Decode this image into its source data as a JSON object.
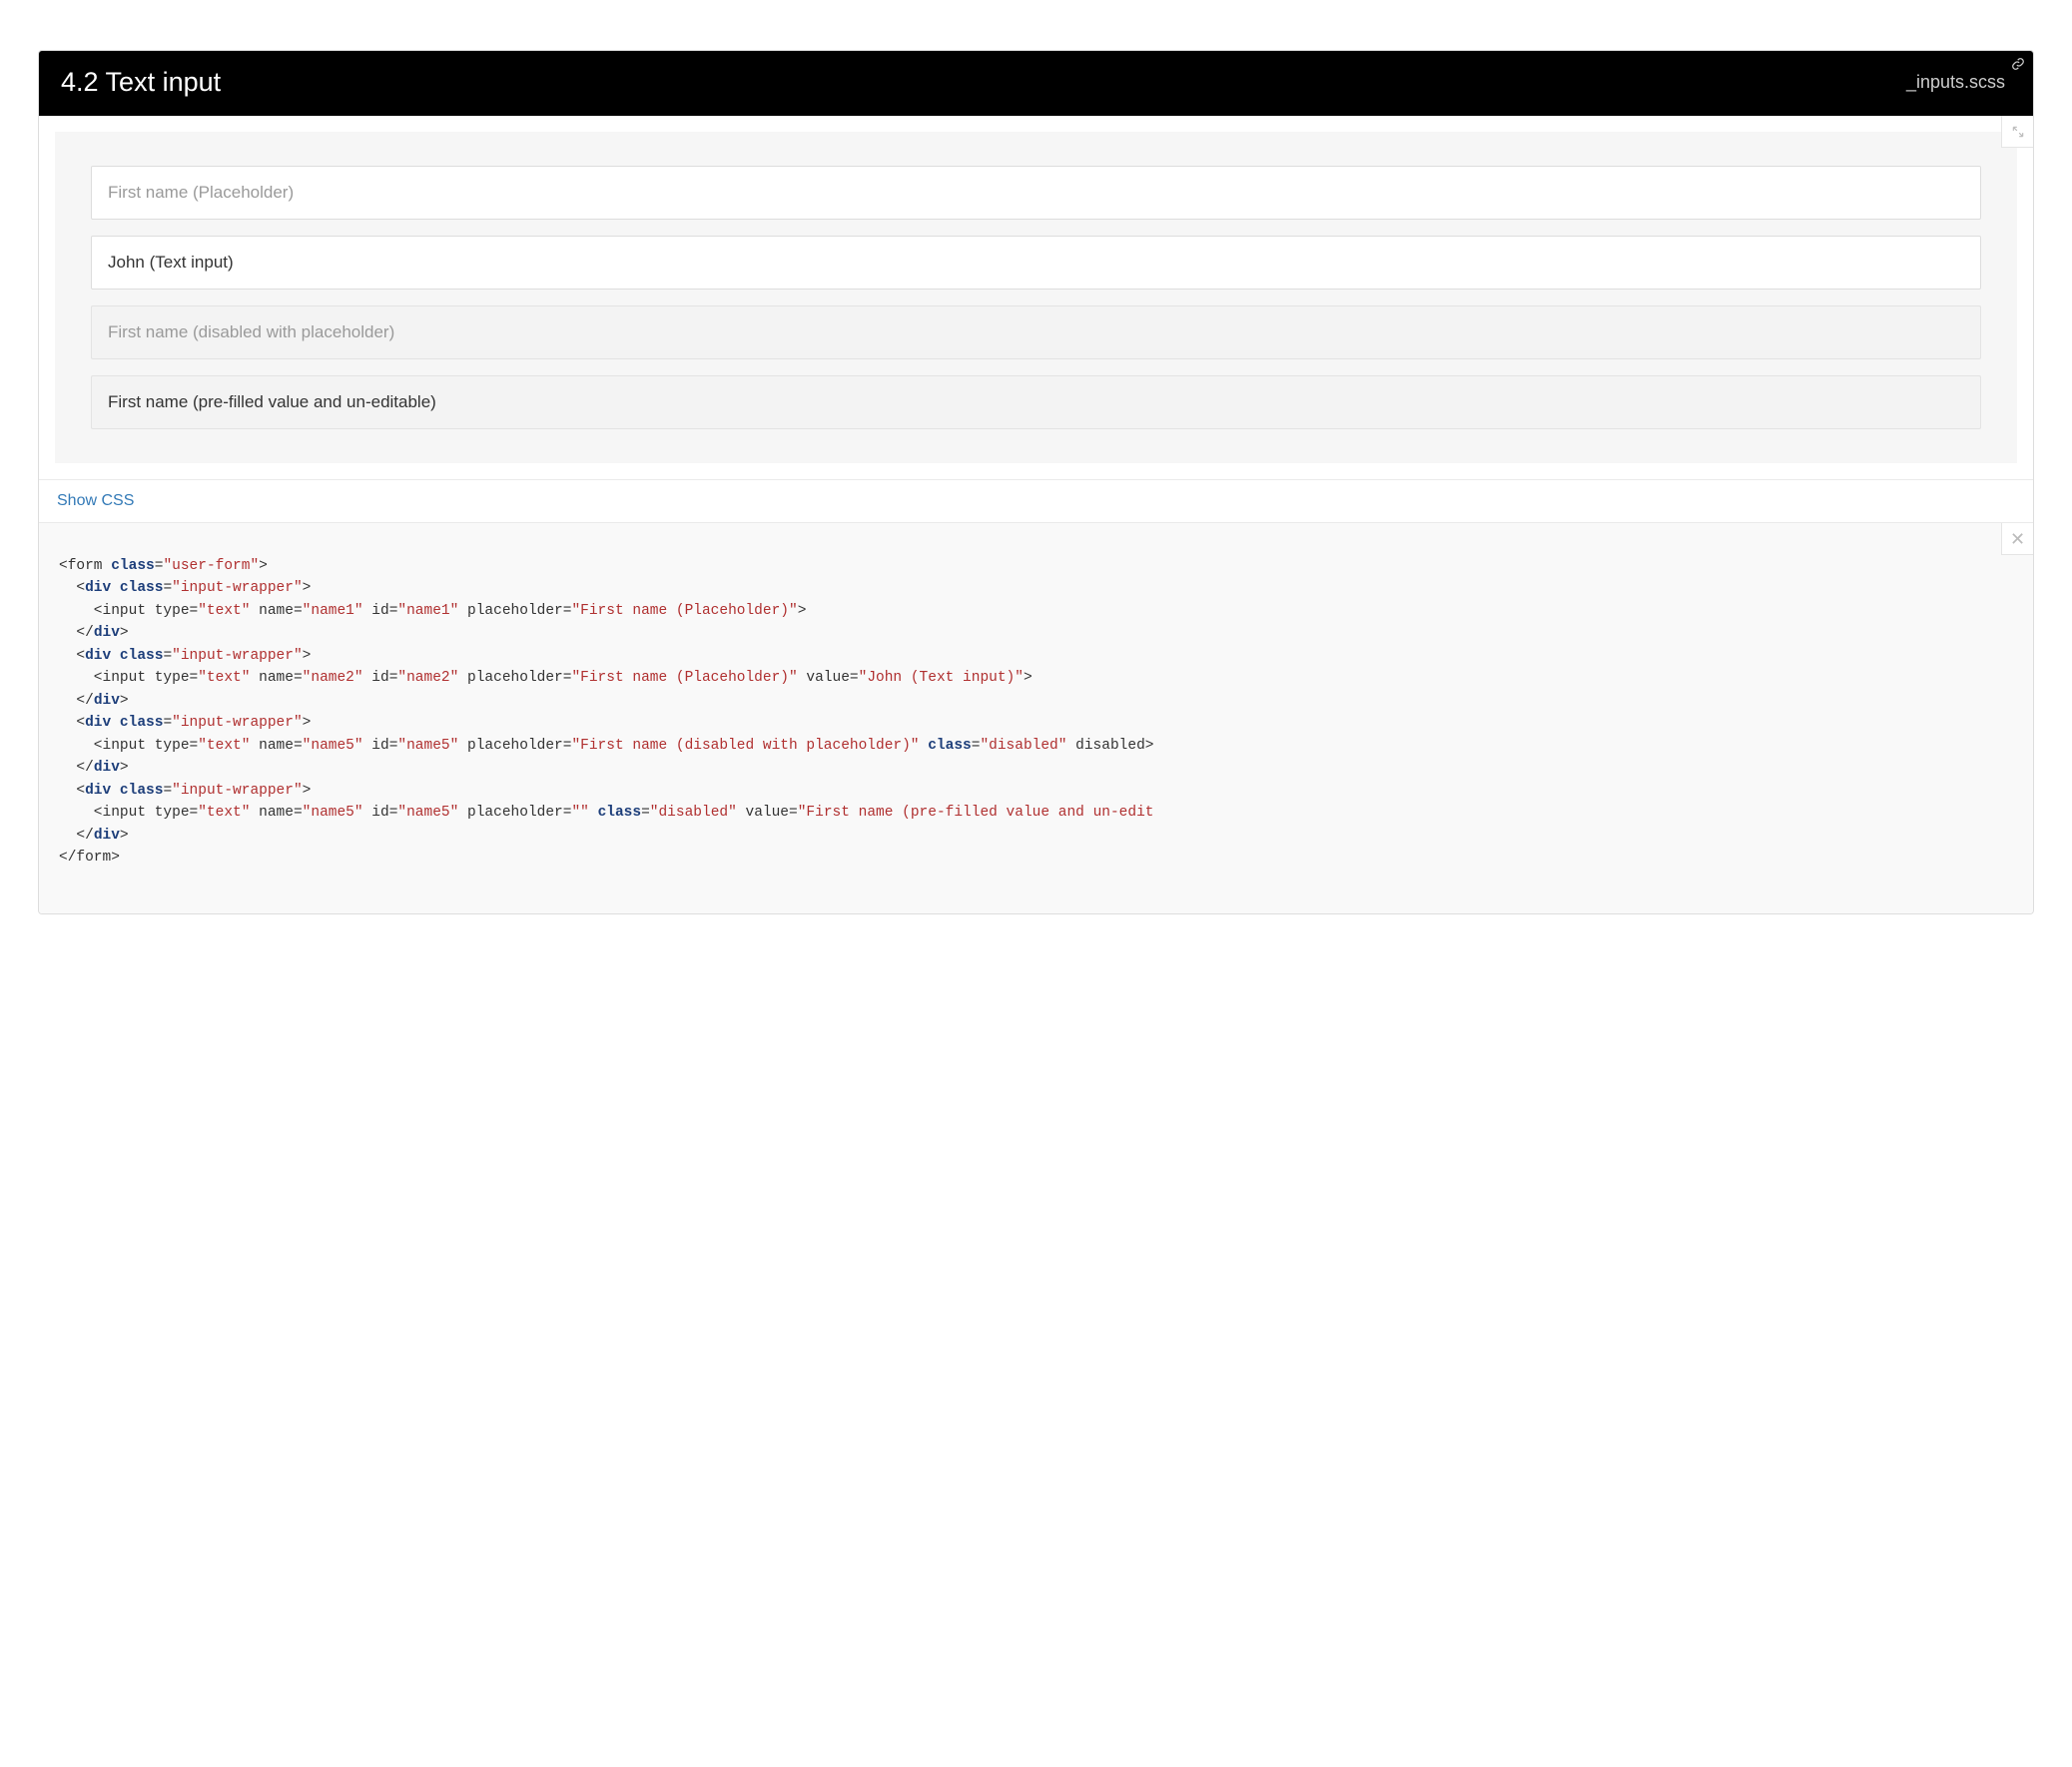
{
  "header": {
    "title": "4.2 Text input",
    "filename": "_inputs.scss"
  },
  "inputs": [
    {
      "placeholder": "First name (Placeholder)",
      "value": "",
      "disabled": false
    },
    {
      "placeholder": "",
      "value": "John (Text input)",
      "disabled": false
    },
    {
      "placeholder": "First name (disabled with placeholder)",
      "value": "",
      "disabled": true
    },
    {
      "placeholder": "",
      "value": "First name (pre-filled value and un-editable)",
      "disabled": true
    }
  ],
  "toggle": {
    "label": "Show CSS"
  },
  "code": {
    "l1a": "<form ",
    "l1_class_kw": "class",
    "l1_eq": "=",
    "l1_class_val": "\"user-form\"",
    "l1b": ">",
    "div_open_a": "  <",
    "div_tag": "div",
    "sp": " ",
    "class_kw": "class",
    "eq": "=",
    "iw_val": "\"input-wrapper\"",
    "gt": ">",
    "input_lead": "    <input type=",
    "type_val": "\"text\"",
    "name_lead": " name=",
    "id_lead": " id=",
    "ph_lead": " placeholder=",
    "val_lead": " value=",
    "cls_lead": " ",
    "cls_kw": "class",
    "dis_val": "\"disabled\"",
    "dis_attr": " disabled",
    "name1": "\"name1\"",
    "name2": "\"name2\"",
    "name5": "\"name5\"",
    "ph1": "\"First name (Placeholder)\"",
    "ph2": "\"First name (Placeholder)\"",
    "v2": "\"John (Text input)\"",
    "ph3": "\"First name (disabled with placeholder)\"",
    "ph4": "\"\"",
    "v4": "\"First name (pre-filled value and un-edit",
    "div_close": "  </",
    "div_close_b": ">",
    "form_close_a": "</form>",
    "tail_gt": ">"
  }
}
